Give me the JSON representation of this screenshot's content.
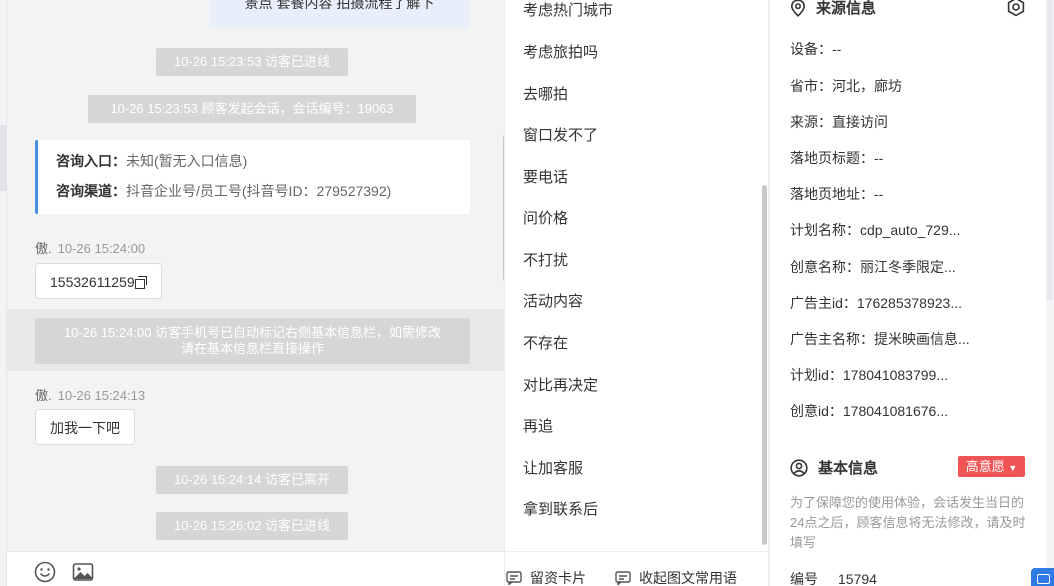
{
  "chat": {
    "top_bubble": "景点 套餐内容 拍摄流程了解下",
    "events": [
      "10-26 15:23:53 访客已进线",
      "10-26 15:23:53 顾客发起会话，会话编号：19063"
    ],
    "info_card": {
      "entry_label": "咨询入口：",
      "entry_value": "未知(暂无入口信息)",
      "channel_label": "咨询渠道：",
      "channel_value": "抖音企业号/员工号(抖音号ID：279527392)"
    },
    "messages": [
      {
        "sender": "傲.",
        "time": "10-26 15:24:00",
        "text": "15532611259"
      },
      {
        "sender": "傲.",
        "time": "10-26 15:24:13",
        "text": "加我一下吧"
      }
    ],
    "auto_mark_notice_line1": "10-26 15:24:00 访客手机号已自动标记右侧基本信息栏，如需修改",
    "auto_mark_notice_line2": "请在基本信息栏直接操作",
    "later_events": [
      "10-26 15:24:14 访客已离开",
      "10-26 15:26:02 访客已进线"
    ]
  },
  "input_bar": {
    "icons": [
      "emoji-icon",
      "image-icon"
    ]
  },
  "phrases": {
    "items": [
      "考虑热门城市",
      "考虑旅拍吗",
      "去哪拍",
      "窗口发不了",
      "要电话",
      "问价格",
      "不打扰",
      "活动内容",
      "不存在",
      "对比再决定",
      "再追",
      "让加客服",
      "拿到联系后"
    ],
    "bottom_card_label": "留资卡片",
    "bottom_collapse_label": "收起图文常用语"
  },
  "panel": {
    "source_title": "来源信息",
    "source_fields": [
      "设备：--",
      "省市：河北，廊坊",
      "来源：直接访问",
      "落地页标题：--",
      "落地页地址：--",
      "计划名称：cdp_auto_729...",
      "创意名称：丽江冬季限定...",
      "广告主id：176285378923...",
      "广告主名称：提米映画信息...",
      "计划id：178041083799...",
      "创意id：178041081676..."
    ],
    "basic_title": "基本信息",
    "intent_badge": "高意愿",
    "note": "为了保障您的使用体验，会话发生当日的24点之后，顾客信息将无法修改，请及时填写",
    "number_label": "编号",
    "number_value": "15794"
  },
  "colors": {
    "accent_blue": "#4a90e2",
    "badge_red": "#f05454",
    "system_gray": "#d6d6d6"
  }
}
